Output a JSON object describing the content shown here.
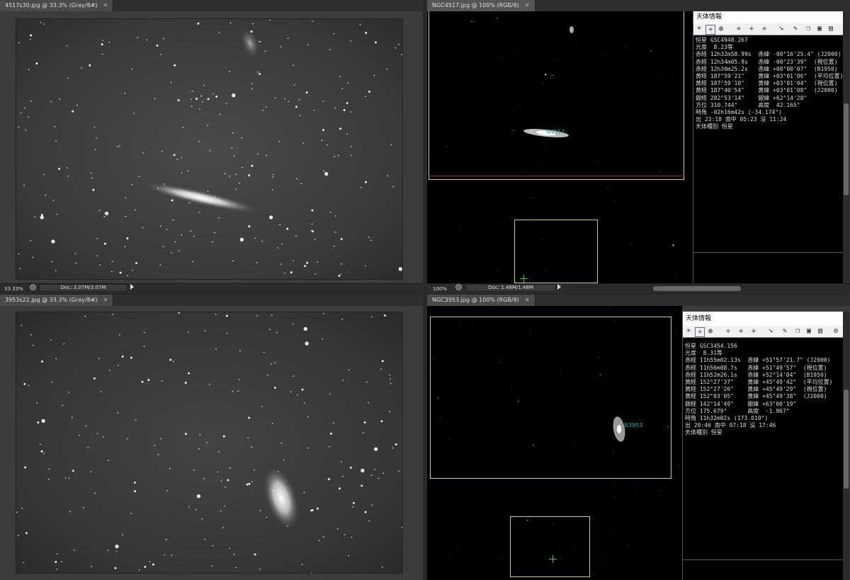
{
  "panes": {
    "top_left": {
      "tab": "4517s30.jpg @ 33.3% (Gray/8#)",
      "zoom": "33.33%",
      "doc": "Doc: 3.07M/3.07M"
    },
    "top_right": {
      "tab": "NGC4517.jpg @ 100% (RGB/8)",
      "zoom": "100%",
      "doc": "Doc: 1.48M/1.48M",
      "object_label": "N4517"
    },
    "bottom_left": {
      "tab": "3953s22.jpg @ 33.3% (Gray/8#)"
    },
    "bottom_right": {
      "tab": "NGC3953.jpg @ 100% (RGB/8)",
      "object_label": "N3953"
    }
  },
  "info_top": {
    "title": "天体情報",
    "lines": [
      "恒星 GSC4948.267",
      "光度  8.23等",
      "赤経 12h32m58.99s  赤緯 -00°16'25.4\" (J2000)",
      "赤経 12h34m05.9s   赤緯 -00°23'39\"  (視位置)",
      "赤経 12h30m25.2s   赤緯 +00°00'07\"  (B1950)",
      "黄経 187°59'21\"    黄緯 +03°01'06\"  (平均位置)",
      "黄経 187°59'10\"    黄緯 +03°01'04\"  (視位置)",
      "黄経 187°40'54\"    黄緯 +03°01'08\"  (J2000)",
      "銀経 282°53'14\"    銀緯 +62°14'28\"",
      "方位 310.744°      高度  42.165°",
      "時角 -02h16m42s (-34.174°)",
      "出 23:18 南中 05:23 没 11:24",
      "天体種別 恒星"
    ]
  },
  "info_bottom": {
    "title": "天体情報",
    "lines": [
      "恒星 GSC3454.156",
      "光度  8.31等",
      "赤経 11h55m02.13s  赤緯 +51°57'21.7\" (J2000)",
      "赤経 11h56m08.7s   赤緯 +51°49'57\"  (視位置)",
      "赤経 11h52m26.1s   赤緯 +52°14'04\"  (B1950)",
      "黄経 152°27'37\"    黄緯 +45°49'42\"  (平均位置)",
      "黄経 152°27'26\"    黄緯 +45°49'29\"  (視位置)",
      "黄経 152°03'05\"    黄緯 +45°49'38\"  (J2000)",
      "銀経 142°14'49\"    銀緯 +63°00'19\"",
      "方位 175.679°      高度  -1.967°",
      "時角 11h32m02s (173.010°)",
      "出 20:46 南中 07:18 没 17:46",
      "天体種別 恒星"
    ]
  },
  "icons": {
    "star_tool": "sun-icon",
    "select_tool": "select-star-icon",
    "group_tool": "group-icon",
    "cross_tool": "crosshair-icon",
    "pen_tool": "pen-icon",
    "window_tool": "window-icon",
    "image_tool": "image-icon"
  }
}
